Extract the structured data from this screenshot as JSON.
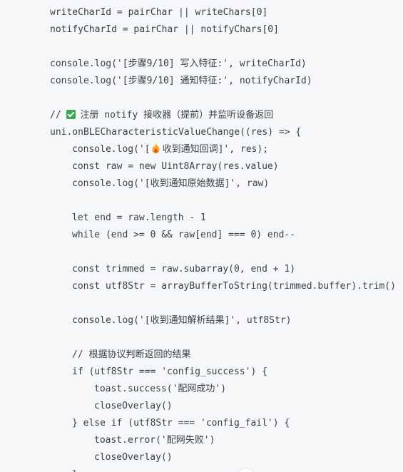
{
  "code": {
    "lines": [
      {
        "indent": 0,
        "text": "writeCharId = pairChar || writeChars[0]"
      },
      {
        "indent": 0,
        "text": "notifyCharId = pairChar || notifyChars[0]"
      },
      {
        "indent": 0,
        "text": ""
      },
      {
        "indent": 0,
        "text": "console.log('[步骤9/10] 写入特征:', writeCharId)"
      },
      {
        "indent": 0,
        "text": "console.log('[步骤9/10] 通知特征:', notifyCharId)"
      },
      {
        "indent": 0,
        "text": ""
      },
      {
        "indent": 0,
        "prefix": "// ",
        "icon": "check-icon",
        "text": "注册 notify 接收器（提前）并监听设备返回"
      },
      {
        "indent": 0,
        "text": "uni.onBLECharacteristicValueChange((res) => {"
      },
      {
        "indent": 1,
        "prefix": "console.log('[",
        "icon": "fire-icon",
        "text": "收到通知回调]', res);"
      },
      {
        "indent": 1,
        "text": "const raw = new Uint8Array(res.value)"
      },
      {
        "indent": 1,
        "text": "console.log('[收到通知原始数据]', raw)"
      },
      {
        "indent": 1,
        "text": ""
      },
      {
        "indent": 1,
        "text": "let end = raw.length - 1"
      },
      {
        "indent": 1,
        "text": "while (end >= 0 && raw[end] === 0) end--"
      },
      {
        "indent": 1,
        "text": ""
      },
      {
        "indent": 1,
        "text": "const trimmed = raw.subarray(0, end + 1)"
      },
      {
        "indent": 1,
        "text": "const utf8Str = arrayBufferToString(trimmed.buffer).trim()"
      },
      {
        "indent": 1,
        "text": ""
      },
      {
        "indent": 1,
        "text": "console.log('[收到通知解析结果]', utf8Str)"
      },
      {
        "indent": 1,
        "text": ""
      },
      {
        "indent": 1,
        "text": "// 根据协议判断返回的结果"
      },
      {
        "indent": 1,
        "text": "if (utf8Str === 'config_success') {"
      },
      {
        "indent": 2,
        "text": "toast.success('配网成功')"
      },
      {
        "indent": 2,
        "text": "closeOverlay()"
      },
      {
        "indent": 1,
        "text": "} else if (utf8Str === 'config_fail') {"
      },
      {
        "indent": 2,
        "text": "toast.error('配网失败')"
      },
      {
        "indent": 2,
        "text": "closeOverlay()"
      },
      {
        "indent": 1,
        "text": "}"
      }
    ]
  },
  "colors": {
    "background": "#f6f7f9",
    "text": "#3b3f46",
    "check_icon": "#3aa757",
    "fire_icon": "#f5a623"
  }
}
